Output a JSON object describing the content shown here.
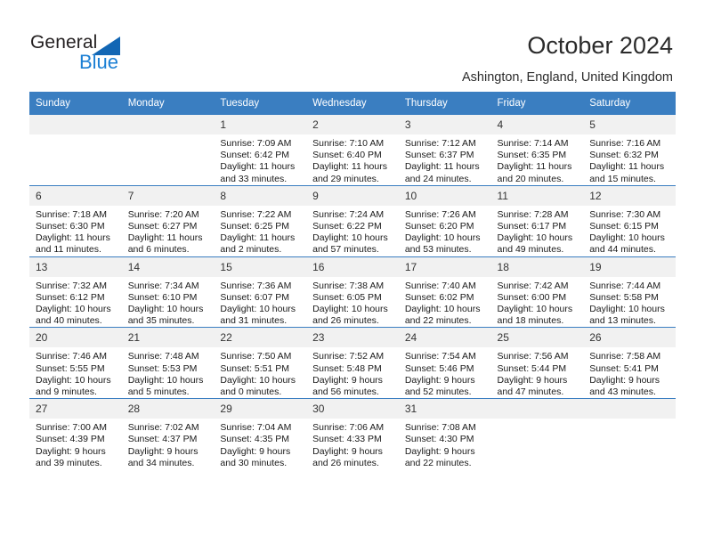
{
  "logo": {
    "text_primary": "General",
    "text_secondary": "Blue",
    "triangle": "logo-triangle",
    "brand_blue": "#1b7fd4",
    "brand_dark_blue": "#1266b4"
  },
  "header": {
    "title": "October 2024",
    "subtitle": "Ashington, England, United Kingdom"
  },
  "calendar": {
    "header_color": "#3a7ec1",
    "daynum_bg": "#f1f1f1",
    "weekday_headers": [
      "Sunday",
      "Monday",
      "Tuesday",
      "Wednesday",
      "Thursday",
      "Friday",
      "Saturday"
    ],
    "weeks": [
      [
        {
          "day": "",
          "sunrise": "",
          "sunset": "",
          "daylight_line1": "",
          "daylight_line2": ""
        },
        {
          "day": "",
          "sunrise": "",
          "sunset": "",
          "daylight_line1": "",
          "daylight_line2": ""
        },
        {
          "day": "1",
          "sunrise": "Sunrise: 7:09 AM",
          "sunset": "Sunset: 6:42 PM",
          "daylight_line1": "Daylight: 11 hours",
          "daylight_line2": "and 33 minutes."
        },
        {
          "day": "2",
          "sunrise": "Sunrise: 7:10 AM",
          "sunset": "Sunset: 6:40 PM",
          "daylight_line1": "Daylight: 11 hours",
          "daylight_line2": "and 29 minutes."
        },
        {
          "day": "3",
          "sunrise": "Sunrise: 7:12 AM",
          "sunset": "Sunset: 6:37 PM",
          "daylight_line1": "Daylight: 11 hours",
          "daylight_line2": "and 24 minutes."
        },
        {
          "day": "4",
          "sunrise": "Sunrise: 7:14 AM",
          "sunset": "Sunset: 6:35 PM",
          "daylight_line1": "Daylight: 11 hours",
          "daylight_line2": "and 20 minutes."
        },
        {
          "day": "5",
          "sunrise": "Sunrise: 7:16 AM",
          "sunset": "Sunset: 6:32 PM",
          "daylight_line1": "Daylight: 11 hours",
          "daylight_line2": "and 15 minutes."
        }
      ],
      [
        {
          "day": "6",
          "sunrise": "Sunrise: 7:18 AM",
          "sunset": "Sunset: 6:30 PM",
          "daylight_line1": "Daylight: 11 hours",
          "daylight_line2": "and 11 minutes."
        },
        {
          "day": "7",
          "sunrise": "Sunrise: 7:20 AM",
          "sunset": "Sunset: 6:27 PM",
          "daylight_line1": "Daylight: 11 hours",
          "daylight_line2": "and 6 minutes."
        },
        {
          "day": "8",
          "sunrise": "Sunrise: 7:22 AM",
          "sunset": "Sunset: 6:25 PM",
          "daylight_line1": "Daylight: 11 hours",
          "daylight_line2": "and 2 minutes."
        },
        {
          "day": "9",
          "sunrise": "Sunrise: 7:24 AM",
          "sunset": "Sunset: 6:22 PM",
          "daylight_line1": "Daylight: 10 hours",
          "daylight_line2": "and 57 minutes."
        },
        {
          "day": "10",
          "sunrise": "Sunrise: 7:26 AM",
          "sunset": "Sunset: 6:20 PM",
          "daylight_line1": "Daylight: 10 hours",
          "daylight_line2": "and 53 minutes."
        },
        {
          "day": "11",
          "sunrise": "Sunrise: 7:28 AM",
          "sunset": "Sunset: 6:17 PM",
          "daylight_line1": "Daylight: 10 hours",
          "daylight_line2": "and 49 minutes."
        },
        {
          "day": "12",
          "sunrise": "Sunrise: 7:30 AM",
          "sunset": "Sunset: 6:15 PM",
          "daylight_line1": "Daylight: 10 hours",
          "daylight_line2": "and 44 minutes."
        }
      ],
      [
        {
          "day": "13",
          "sunrise": "Sunrise: 7:32 AM",
          "sunset": "Sunset: 6:12 PM",
          "daylight_line1": "Daylight: 10 hours",
          "daylight_line2": "and 40 minutes."
        },
        {
          "day": "14",
          "sunrise": "Sunrise: 7:34 AM",
          "sunset": "Sunset: 6:10 PM",
          "daylight_line1": "Daylight: 10 hours",
          "daylight_line2": "and 35 minutes."
        },
        {
          "day": "15",
          "sunrise": "Sunrise: 7:36 AM",
          "sunset": "Sunset: 6:07 PM",
          "daylight_line1": "Daylight: 10 hours",
          "daylight_line2": "and 31 minutes."
        },
        {
          "day": "16",
          "sunrise": "Sunrise: 7:38 AM",
          "sunset": "Sunset: 6:05 PM",
          "daylight_line1": "Daylight: 10 hours",
          "daylight_line2": "and 26 minutes."
        },
        {
          "day": "17",
          "sunrise": "Sunrise: 7:40 AM",
          "sunset": "Sunset: 6:02 PM",
          "daylight_line1": "Daylight: 10 hours",
          "daylight_line2": "and 22 minutes."
        },
        {
          "day": "18",
          "sunrise": "Sunrise: 7:42 AM",
          "sunset": "Sunset: 6:00 PM",
          "daylight_line1": "Daylight: 10 hours",
          "daylight_line2": "and 18 minutes."
        },
        {
          "day": "19",
          "sunrise": "Sunrise: 7:44 AM",
          "sunset": "Sunset: 5:58 PM",
          "daylight_line1": "Daylight: 10 hours",
          "daylight_line2": "and 13 minutes."
        }
      ],
      [
        {
          "day": "20",
          "sunrise": "Sunrise: 7:46 AM",
          "sunset": "Sunset: 5:55 PM",
          "daylight_line1": "Daylight: 10 hours",
          "daylight_line2": "and 9 minutes."
        },
        {
          "day": "21",
          "sunrise": "Sunrise: 7:48 AM",
          "sunset": "Sunset: 5:53 PM",
          "daylight_line1": "Daylight: 10 hours",
          "daylight_line2": "and 5 minutes."
        },
        {
          "day": "22",
          "sunrise": "Sunrise: 7:50 AM",
          "sunset": "Sunset: 5:51 PM",
          "daylight_line1": "Daylight: 10 hours",
          "daylight_line2": "and 0 minutes."
        },
        {
          "day": "23",
          "sunrise": "Sunrise: 7:52 AM",
          "sunset": "Sunset: 5:48 PM",
          "daylight_line1": "Daylight: 9 hours",
          "daylight_line2": "and 56 minutes."
        },
        {
          "day": "24",
          "sunrise": "Sunrise: 7:54 AM",
          "sunset": "Sunset: 5:46 PM",
          "daylight_line1": "Daylight: 9 hours",
          "daylight_line2": "and 52 minutes."
        },
        {
          "day": "25",
          "sunrise": "Sunrise: 7:56 AM",
          "sunset": "Sunset: 5:44 PM",
          "daylight_line1": "Daylight: 9 hours",
          "daylight_line2": "and 47 minutes."
        },
        {
          "day": "26",
          "sunrise": "Sunrise: 7:58 AM",
          "sunset": "Sunset: 5:41 PM",
          "daylight_line1": "Daylight: 9 hours",
          "daylight_line2": "and 43 minutes."
        }
      ],
      [
        {
          "day": "27",
          "sunrise": "Sunrise: 7:00 AM",
          "sunset": "Sunset: 4:39 PM",
          "daylight_line1": "Daylight: 9 hours",
          "daylight_line2": "and 39 minutes."
        },
        {
          "day": "28",
          "sunrise": "Sunrise: 7:02 AM",
          "sunset": "Sunset: 4:37 PM",
          "daylight_line1": "Daylight: 9 hours",
          "daylight_line2": "and 34 minutes."
        },
        {
          "day": "29",
          "sunrise": "Sunrise: 7:04 AM",
          "sunset": "Sunset: 4:35 PM",
          "daylight_line1": "Daylight: 9 hours",
          "daylight_line2": "and 30 minutes."
        },
        {
          "day": "30",
          "sunrise": "Sunrise: 7:06 AM",
          "sunset": "Sunset: 4:33 PM",
          "daylight_line1": "Daylight: 9 hours",
          "daylight_line2": "and 26 minutes."
        },
        {
          "day": "31",
          "sunrise": "Sunrise: 7:08 AM",
          "sunset": "Sunset: 4:30 PM",
          "daylight_line1": "Daylight: 9 hours",
          "daylight_line2": "and 22 minutes."
        },
        {
          "day": "",
          "sunrise": "",
          "sunset": "",
          "daylight_line1": "",
          "daylight_line2": ""
        },
        {
          "day": "",
          "sunrise": "",
          "sunset": "",
          "daylight_line1": "",
          "daylight_line2": ""
        }
      ]
    ]
  }
}
